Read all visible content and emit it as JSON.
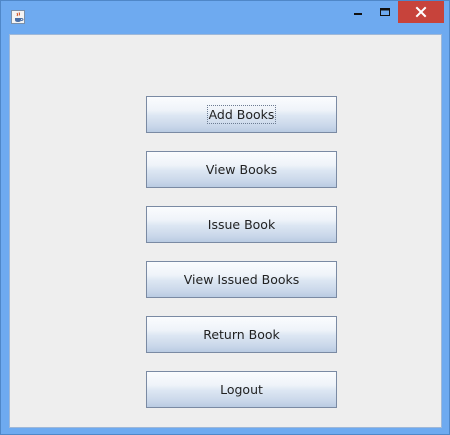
{
  "window": {
    "title": "",
    "icons": {
      "app": "java-cup-icon",
      "minimize": "minimize-icon",
      "maximize": "maximize-icon",
      "close": "close-icon"
    },
    "colors": {
      "frame": "#6eaaf0",
      "close": "#c7433b",
      "client": "#eeeeee"
    }
  },
  "menu": {
    "buttons": [
      {
        "label": "Add Books",
        "focused": true
      },
      {
        "label": "View Books",
        "focused": false
      },
      {
        "label": "Issue Book",
        "focused": false
      },
      {
        "label": "View Issued Books",
        "focused": false
      },
      {
        "label": "Return Book",
        "focused": false
      },
      {
        "label": "Logout",
        "focused": false
      }
    ]
  }
}
